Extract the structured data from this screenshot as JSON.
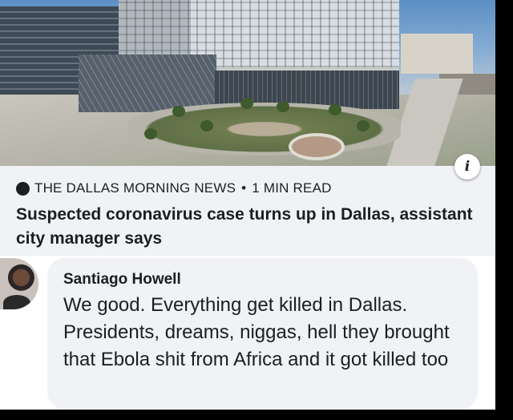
{
  "link_preview": {
    "source": "THE DALLAS MORNING NEWS",
    "separator": "•",
    "read_time": "1 MIN READ",
    "headline": "Suspected coronavirus case turns up in Dallas, assistant city manager says",
    "info_badge": "i",
    "source_icon": "compass-icon"
  },
  "comment": {
    "author": "Santiago Howell",
    "text": "We good. Everything get killed in Dallas. Presidents, dreams, niggas, hell they brought that Ebola shit from Africa and it got killed too"
  },
  "colors": {
    "card_background": "#f0f2f5",
    "text": "#1c1e21",
    "outer_background": "#000000"
  }
}
